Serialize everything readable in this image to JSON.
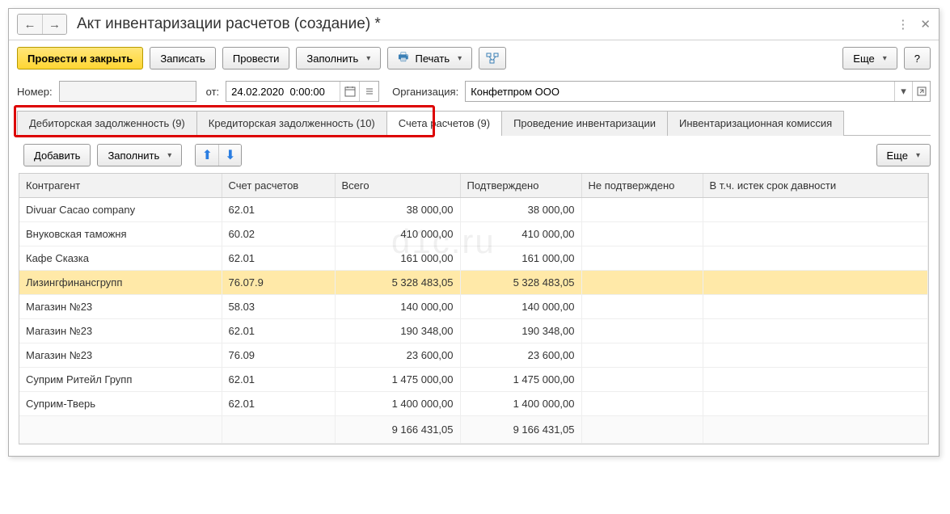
{
  "title": "Акт инвентаризации расчетов (создание) *",
  "toolbar": {
    "post_close": "Провести и закрыть",
    "write": "Записать",
    "post": "Провести",
    "fill": "Заполнить",
    "print": "Печать",
    "more": "Еще",
    "help": "?"
  },
  "form": {
    "number_label": "Номер:",
    "number_value": "",
    "from_label": "от:",
    "date_value": "24.02.2020  0:00:00",
    "org_label": "Организация:",
    "org_value": "Конфетпром ООО"
  },
  "tabs": [
    "Дебиторская задолженность (9)",
    "Кредиторская задолженность (10)",
    "Счета расчетов (9)",
    "Проведение инвентаризации",
    "Инвентаризационная комиссия"
  ],
  "tab_toolbar": {
    "add": "Добавить",
    "fill": "Заполнить",
    "more": "Еще"
  },
  "columns": [
    "Контрагент",
    "Счет расчетов",
    "Всего",
    "Подтверждено",
    "Не подтверждено",
    "В т.ч. истек срок давности"
  ],
  "rows": [
    {
      "name": "Divuar Cacao company",
      "acct": "62.01",
      "total": "38 000,00",
      "conf": "38 000,00",
      "unconf": "",
      "exp": ""
    },
    {
      "name": "Внуковская таможня",
      "acct": "60.02",
      "total": "410 000,00",
      "conf": "410 000,00",
      "unconf": "",
      "exp": ""
    },
    {
      "name": "Кафе Сказка",
      "acct": "62.01",
      "total": "161 000,00",
      "conf": "161 000,00",
      "unconf": "",
      "exp": ""
    },
    {
      "name": "Лизингфинансгрупп",
      "acct": "76.07.9",
      "total": "5 328 483,05",
      "conf": "5 328 483,05",
      "unconf": "",
      "exp": "",
      "selected": true
    },
    {
      "name": "Магазин №23",
      "acct": "58.03",
      "total": "140 000,00",
      "conf": "140 000,00",
      "unconf": "",
      "exp": ""
    },
    {
      "name": "Магазин №23",
      "acct": "62.01",
      "total": "190 348,00",
      "conf": "190 348,00",
      "unconf": "",
      "exp": ""
    },
    {
      "name": "Магазин №23",
      "acct": "76.09",
      "total": "23 600,00",
      "conf": "23 600,00",
      "unconf": "",
      "exp": ""
    },
    {
      "name": "Суприм Ритейл Групп",
      "acct": "62.01",
      "total": "1 475 000,00",
      "conf": "1 475 000,00",
      "unconf": "",
      "exp": ""
    },
    {
      "name": "Суприм-Тверь",
      "acct": "62.01",
      "total": "1 400 000,00",
      "conf": "1 400 000,00",
      "unconf": "",
      "exp": ""
    }
  ],
  "totals": {
    "total": "9 166 431,05",
    "conf": "9 166 431,05"
  },
  "watermark": "d1с.ru"
}
